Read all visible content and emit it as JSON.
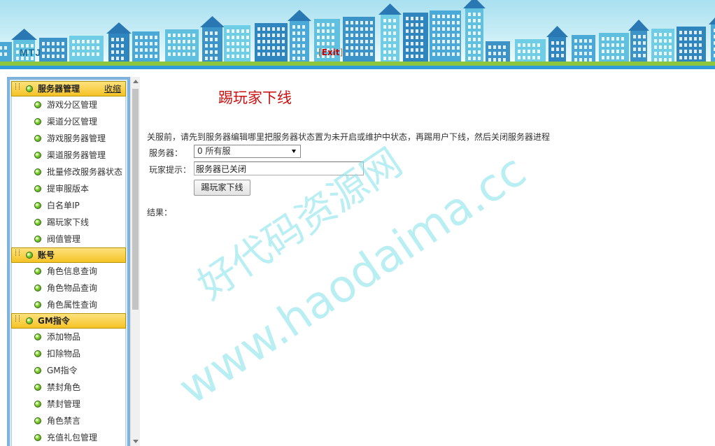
{
  "header": {
    "brand": "MTJ",
    "exit_open": "[",
    "exit_label": "Exit",
    "exit_close": "]"
  },
  "sidebar": {
    "groups": [
      {
        "title": "服务器管理",
        "collapse_label": "收缩",
        "items": [
          "游戏分区管理",
          "渠道分区管理",
          "游戏服务器管理",
          "渠道服务器管理",
          "批量修改服务器状态",
          "提审服版本",
          "白名单IP",
          "踢玩家下线",
          "阀值管理"
        ]
      },
      {
        "title": "账号",
        "items": [
          "角色信息查询",
          "角色物品查询",
          "角色属性查询"
        ]
      },
      {
        "title": "GM指令",
        "items": [
          "添加物品",
          "扣除物品",
          "GM指令",
          "禁封角色",
          "禁封管理",
          "角色禁言",
          "充值礼包管理"
        ]
      }
    ]
  },
  "main": {
    "title": "踢玩家下线",
    "notice": "关服前，请先到服务器编辑哪里把服务器状态置为未开启或维护中状态，再踢用户下线，然后关闭服务器进程",
    "server_label": "服务器：",
    "server_value": "0 所有服",
    "tip_label": "玩家提示：",
    "tip_value": "服务器已关闭",
    "kick_button": "踢玩家下线",
    "result_label": "结果："
  },
  "watermark": {
    "line1": "好代码资源网",
    "line2": "www.haodaima.cc"
  },
  "colors": {
    "title": "#cc1111",
    "group_header": "#f6c326",
    "sidebar_border": "#7fb2dc",
    "watermark": "#7fe0e8"
  }
}
